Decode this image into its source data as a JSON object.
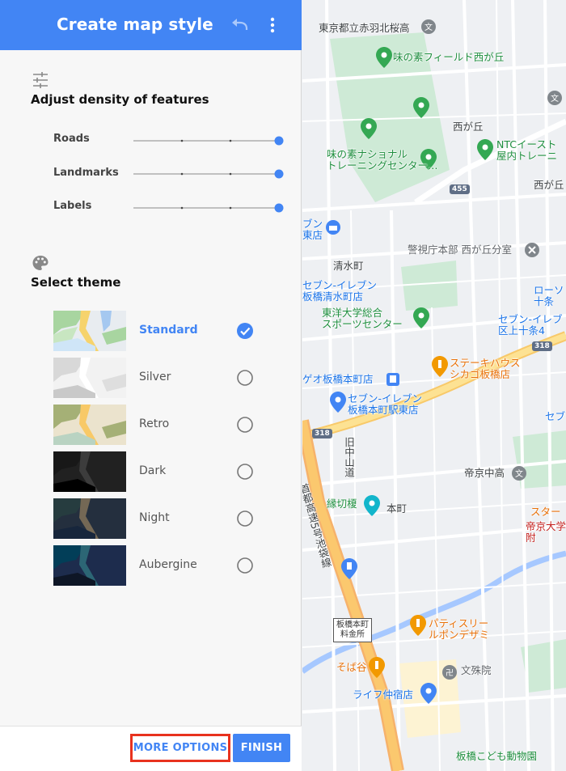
{
  "header": {
    "title": "Create map style",
    "undo_icon": "undo-icon",
    "more_icon": "more-vert-icon",
    "color": "#4285f4"
  },
  "density": {
    "icon": "tune-icon",
    "title": "Adjust density of features",
    "sliders": [
      {
        "label": "Roads",
        "level": 1.0
      },
      {
        "label": "Landmarks",
        "level": 1.0
      },
      {
        "label": "Labels",
        "level": 1.0
      }
    ]
  },
  "theme": {
    "icon": "palette-icon",
    "title": "Select theme",
    "options": [
      {
        "name": "Standard",
        "selected": true
      },
      {
        "name": "Silver",
        "selected": false
      },
      {
        "name": "Retro",
        "selected": false
      },
      {
        "name": "Dark",
        "selected": false
      },
      {
        "name": "Night",
        "selected": false
      },
      {
        "name": "Aubergine",
        "selected": false
      }
    ]
  },
  "footer": {
    "more_options_label": "MORE OPTIONS",
    "finish_label": "FINISH"
  },
  "map": {
    "labels": {
      "tokyo_hs": "東京都立赤羽北桜高",
      "ajinomoto_field": "味の素フィールド西が丘",
      "nishigaoka": "西が丘",
      "ntc": "NTCイースト\n屋内トレーニ",
      "nishigaoka2": "西が丘",
      "ajinomoto_training": "味の素ナショナル\nトレーニングセンター…",
      "seven_top": "ブン\n東店",
      "police": "警視庁本部 西が丘分室",
      "shimizucho": "清水町",
      "seven_shimizu": "セブン-イレブン\n板橋清水町店",
      "toyo": "東洋大学総合\nスポーツセンター",
      "lawson": "ローソ\n十条",
      "seven_kamijujo": "セブン-イレブ\n区上十条4",
      "steak": "ステーキハウス\nシカゴ板橋店",
      "geo": "ゲオ板橋本町店",
      "seven_honcho": "セブン-イレブン\n板橋本町駅東店",
      "seven_right": "セブ",
      "kyu_nakasendo": "旧中山道",
      "teikyo_hs": "帝京中高",
      "shuto": "首都高速5号池袋線",
      "enkiri": "縁切榎",
      "honcho": "本町",
      "star": "スター",
      "teikyo_univ": "帝京大学\n附",
      "toll": "板橋本町\n料金所",
      "patisserie": "パティスリー\nルポンデザミ",
      "sobaga": "そば谷",
      "bunshuin": "文殊院",
      "life": "ライフ仲宿店",
      "zoo": "板橋こども動物園"
    },
    "routes": [
      "455",
      "318",
      "318"
    ]
  }
}
